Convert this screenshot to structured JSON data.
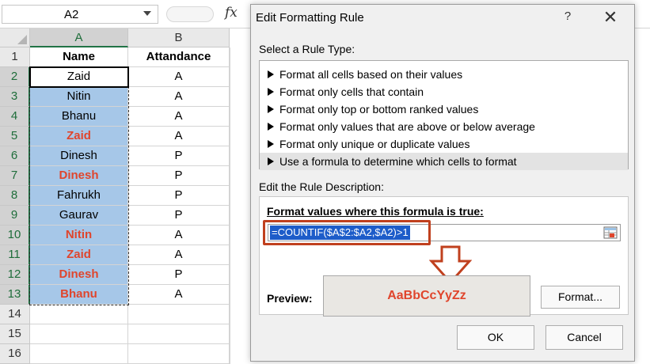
{
  "formula_bar": {
    "name_box": "A2",
    "fx_label": "fx"
  },
  "sheet": {
    "columns": [
      "A",
      "B"
    ],
    "rows": [
      {
        "num": "1",
        "a": "Name",
        "b": "Attandance"
      },
      {
        "num": "2",
        "a": "Zaid",
        "b": "A"
      },
      {
        "num": "3",
        "a": "Nitin",
        "b": "A"
      },
      {
        "num": "4",
        "a": "Bhanu",
        "b": "A"
      },
      {
        "num": "5",
        "a": "Zaid",
        "b": "A"
      },
      {
        "num": "6",
        "a": "Dinesh",
        "b": "P"
      },
      {
        "num": "7",
        "a": "Dinesh",
        "b": "P"
      },
      {
        "num": "8",
        "a": "Fahrukh",
        "b": "P"
      },
      {
        "num": "9",
        "a": "Gaurav",
        "b": "P"
      },
      {
        "num": "10",
        "a": "Nitin",
        "b": "A"
      },
      {
        "num": "11",
        "a": "Zaid",
        "b": "A"
      },
      {
        "num": "12",
        "a": "Dinesh",
        "b": "P"
      },
      {
        "num": "13",
        "a": "Bhanu",
        "b": "A"
      },
      {
        "num": "14",
        "a": "",
        "b": ""
      },
      {
        "num": "15",
        "a": "",
        "b": ""
      },
      {
        "num": "16",
        "a": "",
        "b": ""
      }
    ],
    "colors": {
      "selection_fill": "#a6c7e8",
      "duplicate_text": "#e0452c"
    }
  },
  "dialog": {
    "title": "Edit Formatting Rule",
    "help": "?",
    "close": "✕",
    "select_rule_type_label": "Select a Rule Type:",
    "rule_types": [
      "Format all cells based on their values",
      "Format only cells that contain",
      "Format only top or bottom ranked values",
      "Format only values that are above or below average",
      "Format only unique or duplicate values",
      "Use a formula to determine which cells to format"
    ],
    "selected_rule_type": "Use a formula to determine which cells to format",
    "edit_description_label": "Edit the Rule Description:",
    "formula_title": "Format values where this formula is true:",
    "formula_value": "=COUNTIF($A$2:$A2,$A2)>1",
    "preview_label": "Preview:",
    "preview_sample": "AaBbCcYyZz",
    "format_button": "Format...",
    "ok_button": "OK",
    "cancel_button": "Cancel",
    "annotation_color": "#c0401e"
  }
}
